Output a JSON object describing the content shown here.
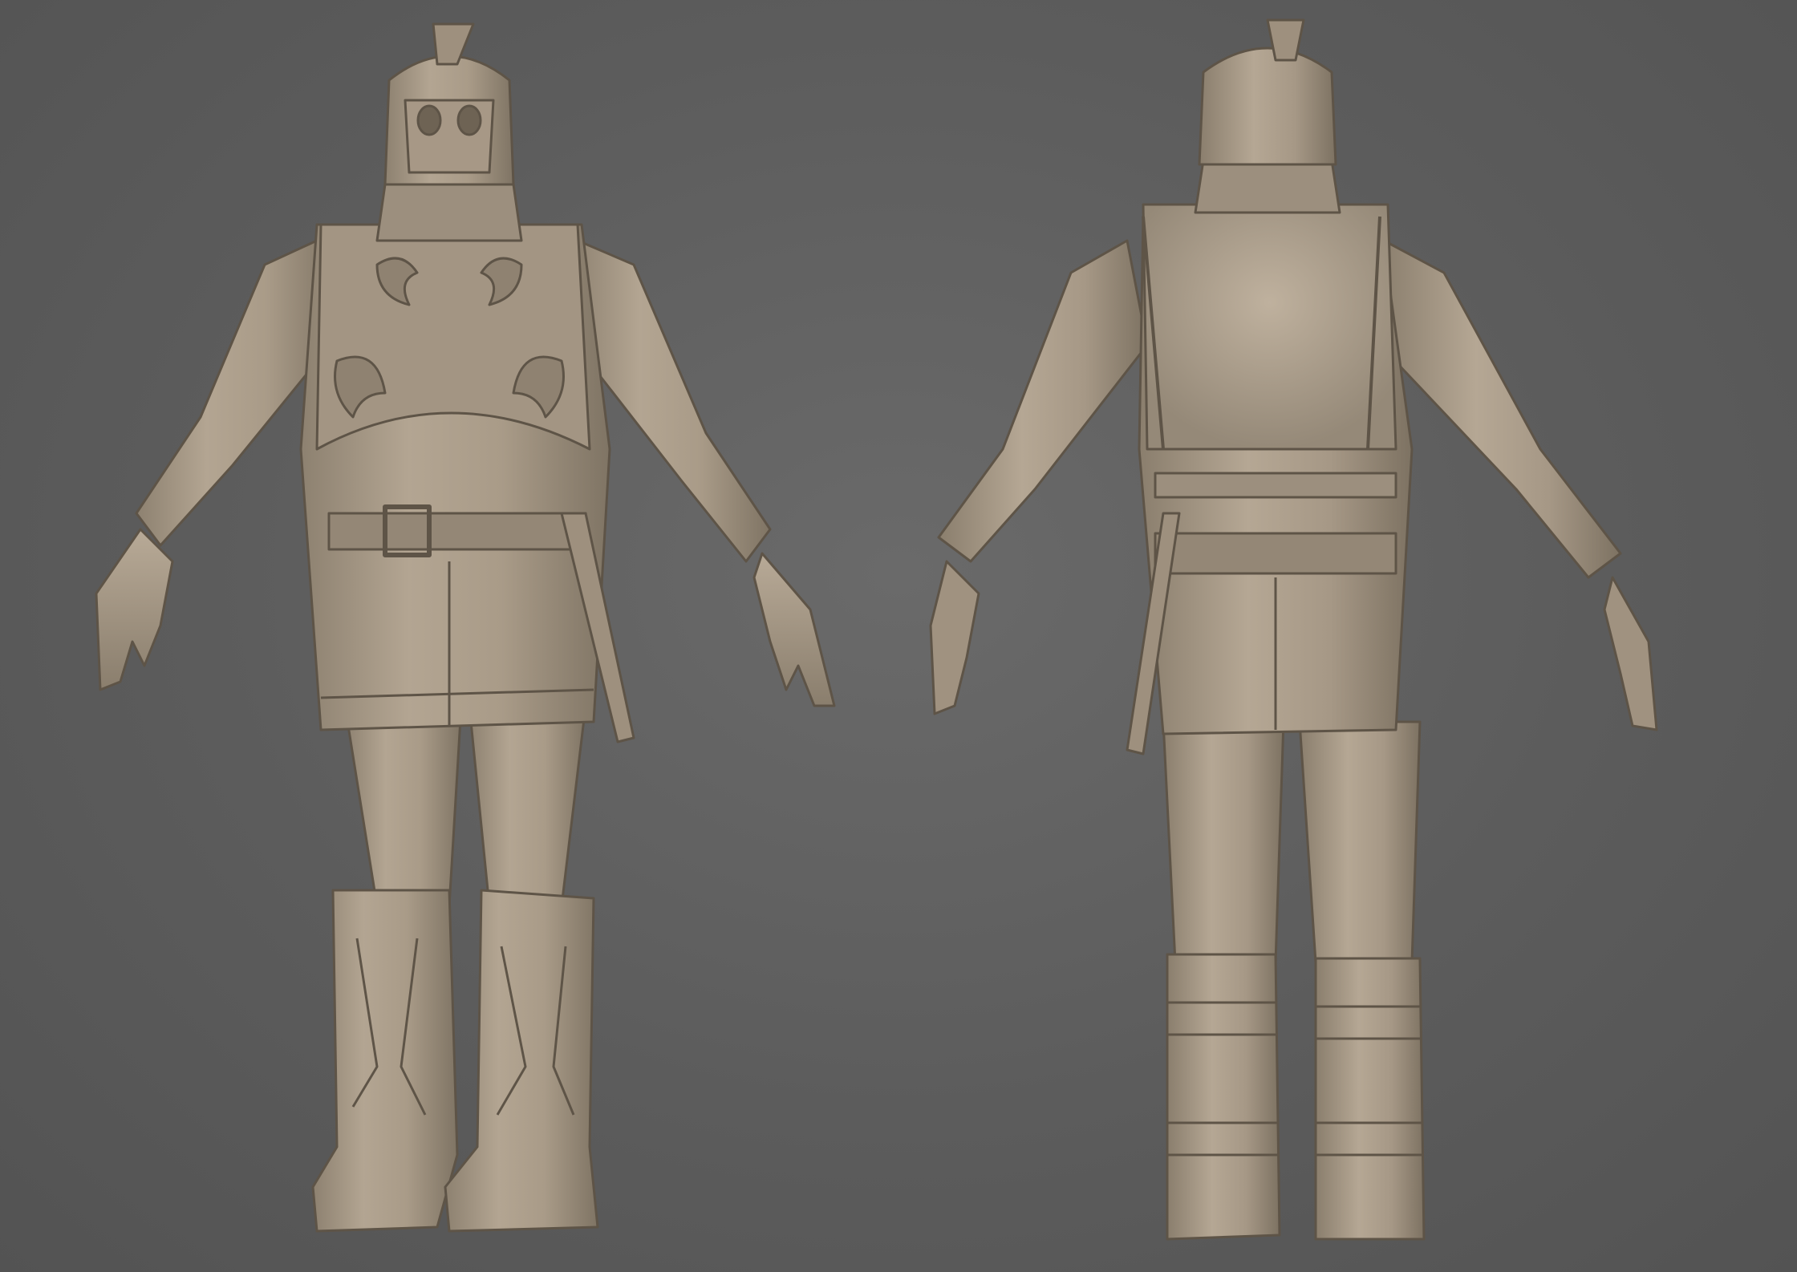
{
  "scene": {
    "background_color": "#5f5f5f",
    "material_color": "#a89a88",
    "views": [
      {
        "id": "front",
        "name": "front-view"
      },
      {
        "id": "back",
        "name": "back-view"
      }
    ]
  }
}
